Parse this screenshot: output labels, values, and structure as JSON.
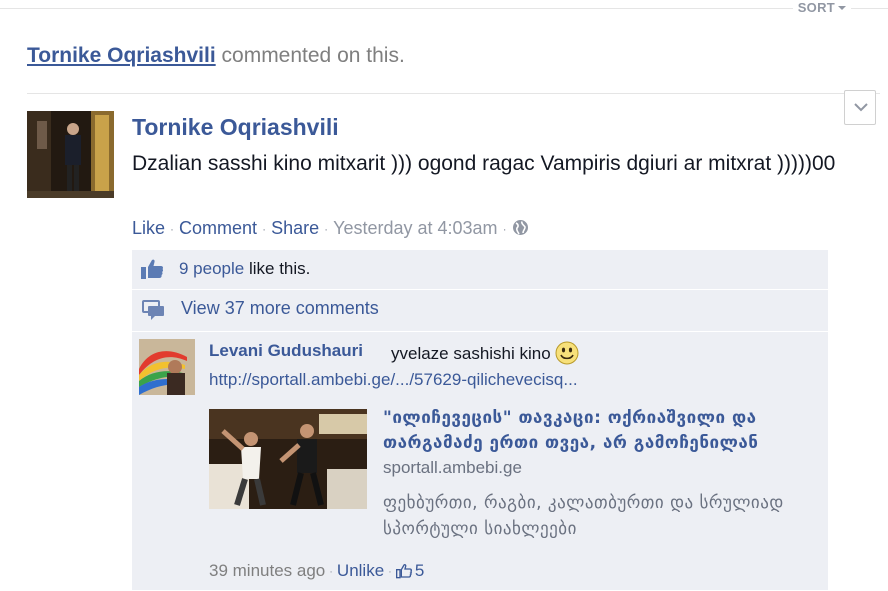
{
  "sort": {
    "label": "SORT"
  },
  "story": {
    "actor": "Tornike Oqriashvili",
    "action": "commented on this."
  },
  "post": {
    "author": "Tornike Oqriashvili",
    "text": "Dzalian sasshi kino mitxarit ))) ogond ragac Vampiris dgiuri ar mitxrat )))))00",
    "actions": {
      "like": "Like",
      "comment": "Comment",
      "share": "Share",
      "timestamp": "Yesterday at 4:03am",
      "privacy_icon": "globe-icon"
    }
  },
  "ufi": {
    "likes_count_text": "9 people",
    "likes_suffix": "like this.",
    "view_more": "View 37 more comments"
  },
  "comment": {
    "author": "Levani Gudushauri",
    "text": "yvelaze sashishi kino",
    "emoticon": "smiley-icon",
    "url": "http://sportall.ambebi.ge/.../57629-qilichevecisq...",
    "share": {
      "title": "\"ილიჩევეცის\" თავკაცი: ოქრიაშვილი და თარგამაძე ერთი თვეა, არ გამოჩენილან",
      "domain": "sportall.ambebi.ge",
      "description": "ფეხბურთი, რაგბი, კალათბურთი და სრულიად სპორტული სიახლეები"
    },
    "time": "39 minutes ago",
    "unlike": "Unlike",
    "like_count": "5"
  },
  "colors": {
    "link": "#3b5998",
    "muted": "#9197a3",
    "ufi_bg": "#edeff4"
  }
}
